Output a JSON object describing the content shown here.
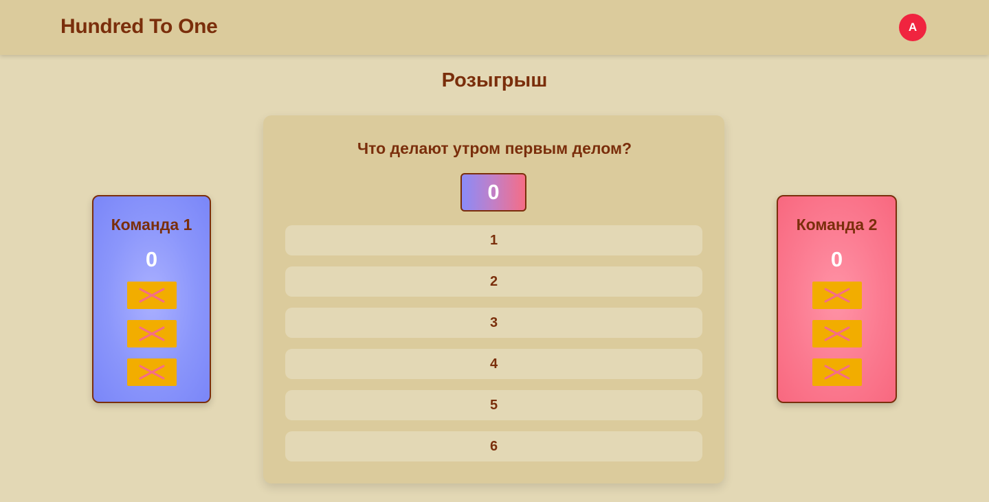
{
  "app": {
    "title": "Hundred To One"
  },
  "user": {
    "avatar_initial": "A"
  },
  "page": {
    "title": "Розыгрыш"
  },
  "round": {
    "question": "Что делают утром первым делом?",
    "bank": "0",
    "answers": [
      "1",
      "2",
      "3",
      "4",
      "5",
      "6"
    ]
  },
  "teams": [
    {
      "name": "Команда 1",
      "score": "0",
      "strikes": [
        "close-icon",
        "close-icon",
        "close-icon"
      ],
      "color": "#8b96fb"
    },
    {
      "name": "Команда 2",
      "score": "0",
      "strikes": [
        "close-icon",
        "close-icon",
        "close-icon"
      ],
      "color": "#fb7a90"
    }
  ],
  "colors": {
    "background": "#e3d8b5",
    "header": "#dbcb9c",
    "text": "#7a2e0b",
    "avatar": "#f0243f",
    "strike_button": "#f2ad00",
    "strike_mark": "#f56d86"
  }
}
